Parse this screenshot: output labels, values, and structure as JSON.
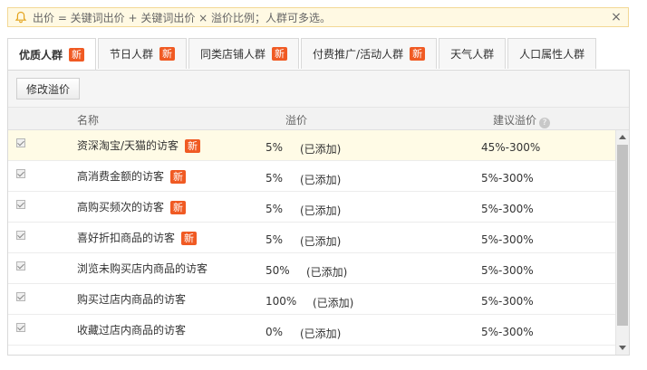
{
  "notice": {
    "text": "出价 = 关键词出价 + 关键词出价 × 溢价比例；人群可多选。",
    "icon": "bell-icon",
    "close": "×"
  },
  "tabs": [
    {
      "label": "优质人群",
      "badge": "新",
      "active": true
    },
    {
      "label": "节日人群",
      "badge": "新",
      "active": false
    },
    {
      "label": "同类店铺人群",
      "badge": "新",
      "active": false
    },
    {
      "label": "付费推广/活动人群",
      "badge": "新",
      "active": false
    },
    {
      "label": "天气人群",
      "badge": "",
      "active": false
    },
    {
      "label": "人口属性人群",
      "badge": "",
      "active": false
    }
  ],
  "toolbar": {
    "modify_label": "修改溢价"
  },
  "table": {
    "headers": {
      "name": "名称",
      "premium": "溢价",
      "suggested": "建议溢价"
    },
    "rows": [
      {
        "name": "资深淘宝/天猫的访客",
        "badge": "新",
        "premium": "5%",
        "status": "(已添加)",
        "suggested": "45%-300%",
        "checked": true
      },
      {
        "name": "高消费金额的访客",
        "badge": "新",
        "premium": "5%",
        "status": "(已添加)",
        "suggested": "5%-300%",
        "checked": true
      },
      {
        "name": "高购买频次的访客",
        "badge": "新",
        "premium": "5%",
        "status": "(已添加)",
        "suggested": "5%-300%",
        "checked": true
      },
      {
        "name": "喜好折扣商品的访客",
        "badge": "新",
        "premium": "5%",
        "status": "(已添加)",
        "suggested": "5%-300%",
        "checked": true
      },
      {
        "name": "浏览未购买店内商品的访客",
        "badge": "",
        "premium": "50%",
        "status": "(已添加)",
        "suggested": "5%-300%",
        "checked": true
      },
      {
        "name": "购买过店内商品的访客",
        "badge": "",
        "premium": "100%",
        "status": "(已添加)",
        "suggested": "5%-300%",
        "checked": true
      },
      {
        "name": "收藏过店内商品的访客",
        "badge": "",
        "premium": "0%",
        "status": "(已添加)",
        "suggested": "5%-300%",
        "checked": true
      }
    ]
  },
  "colors": {
    "accent_badge": "#f05a23",
    "notice_bg": "#fff9e3",
    "highlight_row": "#fffbe6"
  }
}
